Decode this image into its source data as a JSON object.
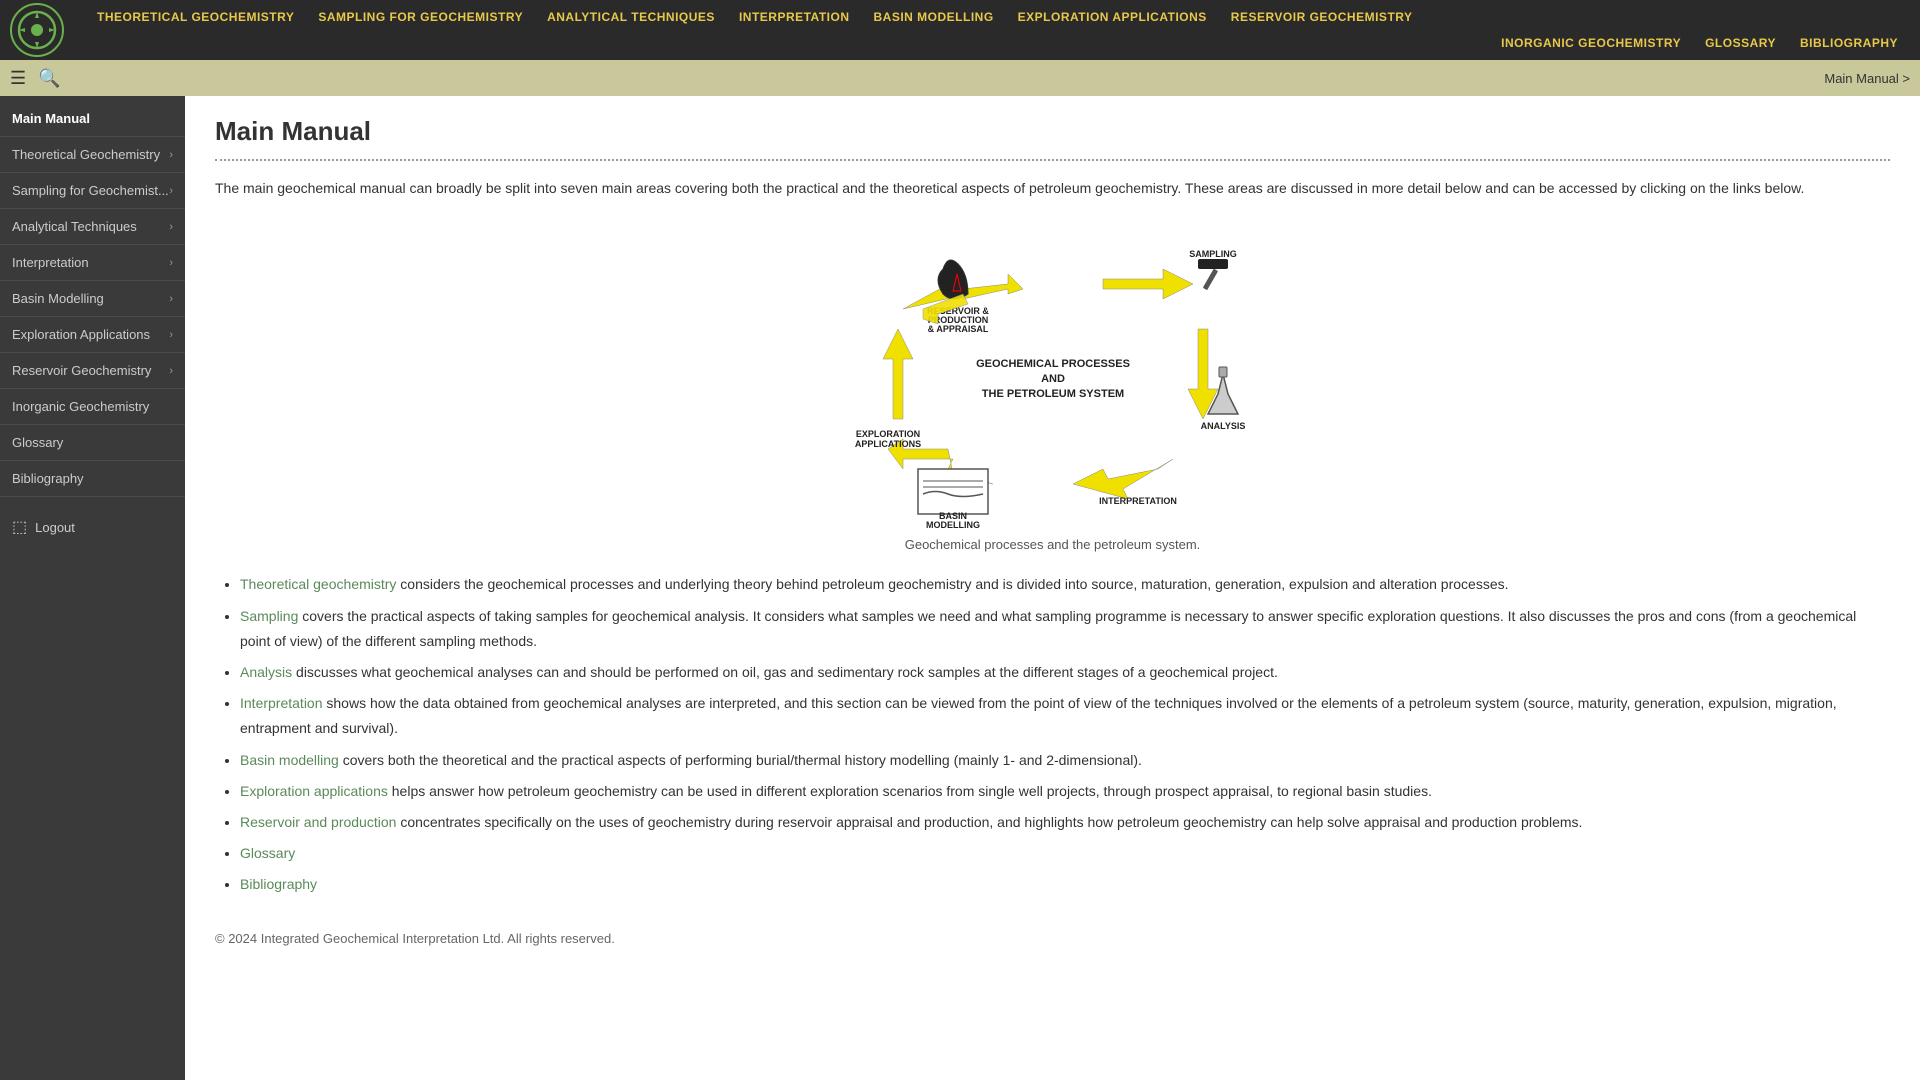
{
  "nav": {
    "links": [
      "THEORETICAL GEOCHEMISTRY",
      "SAMPLING FOR GEOCHEMISTRY",
      "ANALYTICAL TECHNIQUES",
      "INTERPRETATION",
      "BASIN MODELLING",
      "EXPLORATION APPLICATIONS",
      "RESERVOIR GEOCHEMISTRY",
      "INORGANIC GEOCHEMISTRY",
      "GLOSSARY",
      "BIBLIOGRAPHY"
    ]
  },
  "toolbar": {
    "breadcrumb": "Main Manual >"
  },
  "sidebar": {
    "items": [
      {
        "label": "Main Manual",
        "has_arrow": false
      },
      {
        "label": "Theoretical Geochemistry",
        "has_arrow": true
      },
      {
        "label": "Sampling for Geochemist...",
        "has_arrow": true
      },
      {
        "label": "Analytical Techniques",
        "has_arrow": true
      },
      {
        "label": "Interpretation",
        "has_arrow": true
      },
      {
        "label": "Basin Modelling",
        "has_arrow": true
      },
      {
        "label": "Exploration Applications",
        "has_arrow": true
      },
      {
        "label": "Reservoir Geochemistry",
        "has_arrow": true
      },
      {
        "label": "Inorganic Geochemistry",
        "has_arrow": false
      },
      {
        "label": "Glossary",
        "has_arrow": false
      },
      {
        "label": "Bibliography",
        "has_arrow": false
      }
    ],
    "logout_label": "Logout"
  },
  "main": {
    "title": "Main Manual",
    "intro": "The main geochemical manual can broadly be split into seven main areas covering both the practical and the theoretical aspects of petroleum geochemistry. These areas are discussed in more detail below and can be accessed by clicking on the links below.",
    "diagram_caption": "Geochemical processes and the petroleum system.",
    "diagram_nodes": {
      "center_line1": "GEOCHEMICAL PROCESSES",
      "center_line2": "AND",
      "center_line3": "THE PETROLEUM SYSTEM",
      "top_right": "SAMPLING",
      "right": "ANALYSIS",
      "bottom_right": "INTERPRETATION",
      "bottom_left": "BASIN\nMODELLING",
      "left": "EXPLORATION\nAPPLICATIONS",
      "top_left": "RESERVOIR &\nPRODUCTION\n& APPRAISAL"
    },
    "bullets": [
      {
        "link_text": "Theoretical geochemistry",
        "rest": " considers the geochemical processes and underlying theory behind petroleum geochemistry and is divided into source, maturation, generation, expulsion and alteration processes."
      },
      {
        "link_text": "Sampling",
        "rest": " covers the practical aspects of taking samples for geochemical analysis. It considers what samples we need and what sampling programme is necessary to answer specific exploration questions. It also discusses the pros and cons (from a geochemical point of view) of the different sampling methods."
      },
      {
        "link_text": "Analysis",
        "rest": " discusses what geochemical analyses can and should be performed on oil, gas and sedimentary rock samples at the different stages of a geochemical project."
      },
      {
        "link_text": "Interpretation",
        "rest": " shows how the data obtained from geochemical analyses are interpreted, and this section can be viewed from the point of view of the techniques involved or the elements of a petroleum system (source, maturity, generation, expulsion, migration, entrapment and survival)."
      },
      {
        "link_text": "Basin modelling",
        "rest": " covers both the theoretical and the practical aspects of performing burial/thermal history modelling (mainly 1- and 2-dimensional)."
      },
      {
        "link_text": "Exploration applications",
        "rest": " helps answer how petroleum geochemistry can be used in different exploration scenarios from single well projects, through prospect appraisal, to regional basin studies."
      },
      {
        "link_text": "Reservoir and production",
        "rest": " concentrates specifically on the uses of geochemistry during reservoir appraisal and production, and highlights how petroleum geochemistry can help solve appraisal and production problems."
      },
      {
        "link_text": "Glossary",
        "rest": ""
      },
      {
        "link_text": "Bibliography",
        "rest": ""
      }
    ],
    "footer": "© 2024 Integrated Geochemical Interpretation Ltd. All rights reserved."
  }
}
